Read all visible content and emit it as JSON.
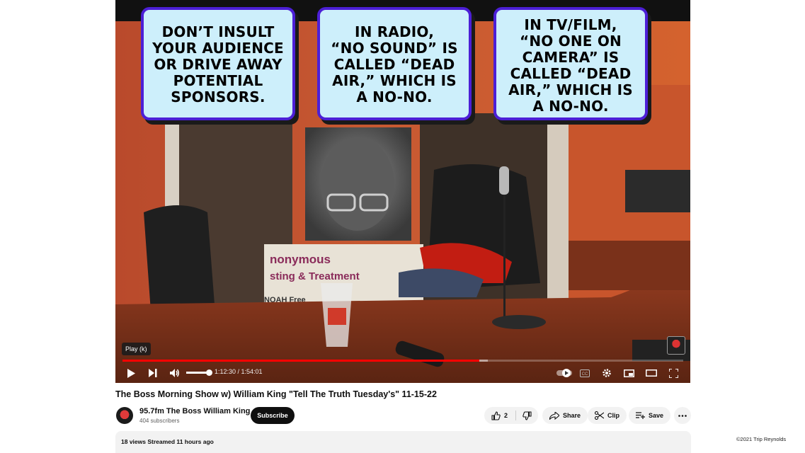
{
  "callouts": [
    {
      "text": "DON’T INSULT\nYOUR AUDIENCE\nOR DRIVE AWAY\nPOTENTIAL\nSPONSORS."
    },
    {
      "text": "IN RADIO,\n“NO SOUND” IS\nCALLED “DEAD\nAIR,”  WHICH IS\nA NO-NO."
    },
    {
      "text": "IN TV/FILM,\n“NO ONE ON\nCAMERA” IS\nCALLED “DEAD\nAIR,” WHICH IS\nA NO-NO."
    }
  ],
  "player": {
    "tooltip": "Play (k)",
    "time": "1:12:30 / 1:54:01",
    "progress_fraction": 0.636,
    "volume_fraction": 1.0,
    "icons": [
      "play-icon",
      "next-icon",
      "volume-icon",
      "autoplay-icon",
      "captions-icon",
      "settings-icon",
      "miniplayer-icon",
      "theater-icon",
      "fullscreen-icon"
    ]
  },
  "video": {
    "title": "The Boss Morning Show w) William King \"Tell The Truth Tuesday's\" 11-15-22"
  },
  "channel": {
    "name": "95.7fm The Boss William King",
    "subscribers": "404 subscribers",
    "subscribe_label": "Subscribe"
  },
  "actions": {
    "like_count": "2",
    "share_label": "Share",
    "clip_label": "Clip",
    "save_label": "Save"
  },
  "description": {
    "stats": "18 views  Streamed 11 hours ago"
  },
  "copyright": "©2021 Trip Reynolds",
  "colors": {
    "callout_bg": "#cdeffb",
    "callout_border": "#4c1fd6",
    "progress": "#ff0000",
    "subscribe_bg": "#0f0f0f"
  }
}
